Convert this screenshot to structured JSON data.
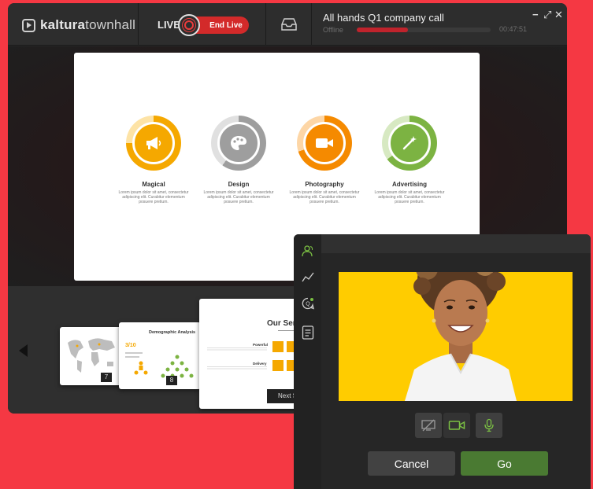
{
  "app": {
    "logo_bold": "kaltura",
    "logo_light": "townhall",
    "live_label": "LIVE",
    "end_live_label": "End Live",
    "event_title": "All hands Q1 company call",
    "event_status": "Offline",
    "event_elapsed": "00:47:51",
    "progress_fraction": 0.38,
    "window_controls": {
      "minimize": "−",
      "maximize": "⤢",
      "close": "✕"
    }
  },
  "slide": {
    "features": [
      {
        "title": "Magical",
        "icon": "megaphone-icon",
        "color": "#f5a800",
        "desc": "Lorem ipsum dolor sit amet, consectetur adipiscing elit. Curabitur elementum posuere pretium."
      },
      {
        "title": "Design",
        "icon": "palette-icon",
        "color": "#9e9e9e",
        "desc": "Lorem ipsum dolor sit amet, consectetur adipiscing elit. Curabitur elementum posuere pretium."
      },
      {
        "title": "Photography",
        "icon": "video-camera-icon",
        "color": "#f58a00",
        "desc": "Lorem ipsum dolor sit amet, consectetur adipiscing elit. Curabitur elementum posuere pretium."
      },
      {
        "title": "Advertising",
        "icon": "magic-wand-icon",
        "color": "#7cb342",
        "desc": "Lorem ipsum dolor sit amet, consectetur adipiscing elit. Curabitur elementum posuere pretium."
      }
    ]
  },
  "filmstrip": {
    "thumbs": [
      {
        "number": "7"
      },
      {
        "number": "8",
        "title": "Demographic Analysis",
        "stat": "3/10"
      },
      {
        "title": "Our Serv",
        "item1": "Powerful",
        "item2": "Delivery",
        "next_label": "Next S"
      }
    ]
  },
  "device_panel": {
    "sidebar_icons": [
      "participants-icon",
      "analytics-icon",
      "qa-icon",
      "notes-icon"
    ],
    "media_buttons": [
      "screen-share-off-icon",
      "camera-icon",
      "microphone-icon"
    ],
    "cancel_label": "Cancel",
    "go_label": "Go",
    "colors": {
      "go": "#4a7a32",
      "cancel": "#424242",
      "active_icon": "#7bc043"
    }
  }
}
